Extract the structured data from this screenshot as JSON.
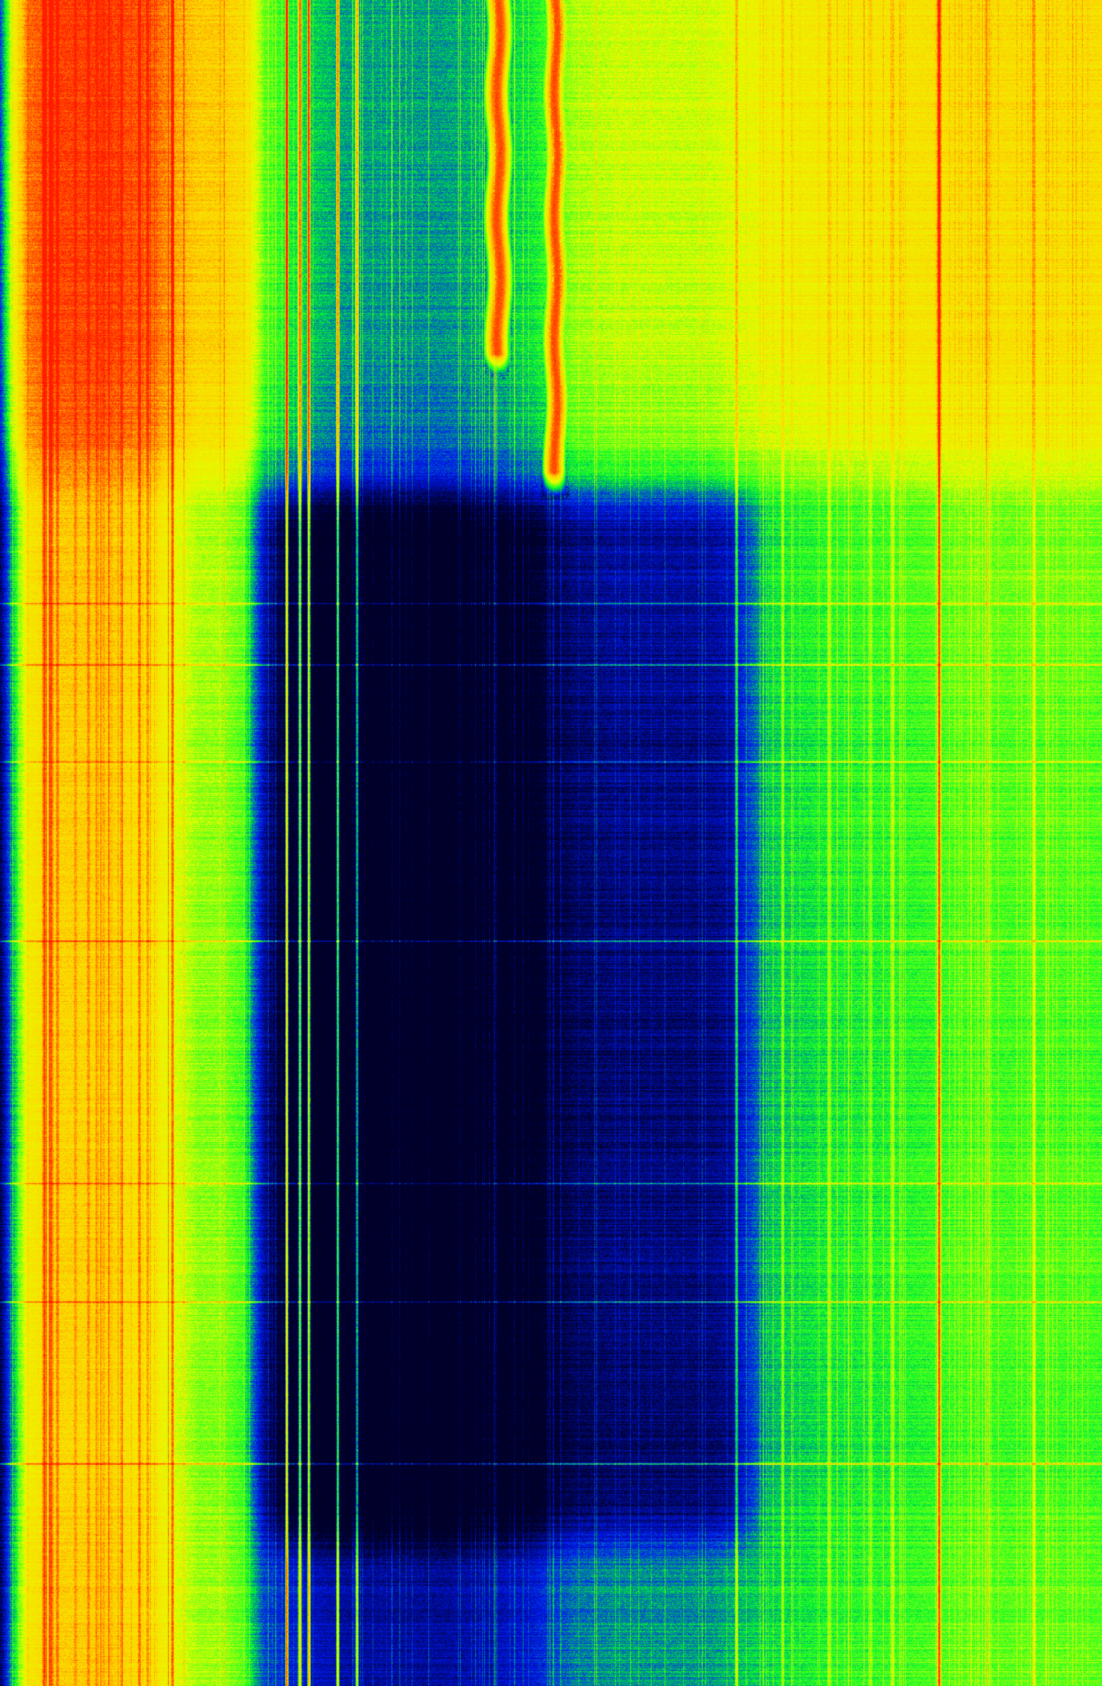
{
  "image": {
    "kind": "spectrogram-waterfall",
    "colormap": [
      "#00002a",
      "#0018ff",
      "#00ff28",
      "#e6ff00",
      "#ffd300",
      "#ff1a00"
    ],
    "background_color": "#1fb89e"
  },
  "chart_data": {
    "type": "heatmap",
    "title": "",
    "xlabel": "",
    "ylabel": "",
    "value_range": [
      0,
      1
    ],
    "column_profile": [
      [
        0.0,
        0.05
      ],
      [
        0.012,
        0.38
      ],
      [
        0.025,
        0.72
      ],
      [
        0.05,
        0.8
      ],
      [
        0.1,
        0.8
      ],
      [
        0.14,
        0.74
      ],
      [
        0.16,
        0.64
      ],
      [
        0.18,
        0.56
      ],
      [
        0.2,
        0.56
      ],
      [
        0.22,
        0.5
      ],
      [
        0.24,
        0.25
      ],
      [
        0.28,
        0.16
      ],
      [
        0.32,
        0.12
      ],
      [
        0.36,
        0.12
      ],
      [
        0.4,
        0.12
      ],
      [
        0.44,
        0.14
      ],
      [
        0.48,
        0.18
      ],
      [
        0.52,
        0.3
      ],
      [
        0.56,
        0.33
      ],
      [
        0.6,
        0.33
      ],
      [
        0.64,
        0.33
      ],
      [
        0.68,
        0.38
      ],
      [
        0.72,
        0.42
      ],
      [
        0.76,
        0.45
      ],
      [
        0.8,
        0.46
      ],
      [
        0.84,
        0.48
      ],
      [
        0.87,
        0.5
      ],
      [
        0.9,
        0.5
      ],
      [
        0.95,
        0.5
      ],
      [
        1.0,
        0.5
      ]
    ],
    "row_profile": [
      [
        0.0,
        0.28
      ],
      [
        0.2,
        0.26
      ],
      [
        0.26,
        0.2
      ],
      [
        0.3,
        0.0
      ],
      [
        0.45,
        -0.03
      ],
      [
        0.62,
        -0.05
      ],
      [
        0.74,
        -0.04
      ],
      [
        0.86,
        -0.06
      ],
      [
        0.93,
        -0.03
      ],
      [
        1.0,
        -0.02
      ]
    ],
    "dim_region": {
      "x": [
        0.22,
        0.7
      ],
      "y": [
        0.28,
        0.93
      ],
      "amount": 0.22
    },
    "bright_tracks": [
      {
        "x": 0.452,
        "width": 0.022,
        "y_end": 0.21,
        "level": 0.95
      },
      {
        "x": 0.504,
        "width": 0.02,
        "y_end": 0.28,
        "level": 0.95
      },
      {
        "x": 0.205,
        "width": 0.018,
        "y_end": 0.2,
        "level": 0.68
      }
    ],
    "vertical_lines": [
      {
        "x": 0.04,
        "level": 0.98,
        "w": 3
      },
      {
        "x": 0.046,
        "level": 0.96,
        "w": 3
      },
      {
        "x": 0.052,
        "level": 0.92,
        "w": 2
      },
      {
        "x": 0.068,
        "level": 0.88,
        "w": 2
      },
      {
        "x": 0.08,
        "level": 0.9,
        "w": 2
      },
      {
        "x": 0.088,
        "level": 0.86,
        "w": 2
      },
      {
        "x": 0.094,
        "level": 0.86,
        "w": 2
      },
      {
        "x": 0.11,
        "level": 0.88,
        "w": 2
      },
      {
        "x": 0.126,
        "level": 0.92,
        "w": 2
      },
      {
        "x": 0.134,
        "level": 0.88,
        "w": 2
      },
      {
        "x": 0.156,
        "level": 0.94,
        "w": 2
      },
      {
        "x": 0.26,
        "level": 0.86,
        "w": 2
      },
      {
        "x": 0.272,
        "level": 0.72,
        "w": 2
      },
      {
        "x": 0.28,
        "level": 0.7,
        "w": 2
      },
      {
        "x": 0.306,
        "level": 0.66,
        "w": 2
      },
      {
        "x": 0.324,
        "level": 0.58,
        "w": 2
      },
      {
        "x": 0.668,
        "level": 0.62,
        "w": 2
      },
      {
        "x": 0.71,
        "level": 0.56,
        "w": 2
      },
      {
        "x": 0.752,
        "level": 0.58,
        "w": 2
      },
      {
        "x": 0.79,
        "level": 0.56,
        "w": 2
      },
      {
        "x": 0.81,
        "level": 0.6,
        "w": 2
      },
      {
        "x": 0.852,
        "level": 0.94,
        "w": 3
      },
      {
        "x": 0.938,
        "level": 0.66,
        "w": 2
      }
    ],
    "horizontal_bands": [
      {
        "y": 0.358,
        "level": 0.3
      },
      {
        "y": 0.394,
        "level": 0.28
      },
      {
        "y": 0.452,
        "level": 0.25
      },
      {
        "y": 0.558,
        "level": 0.3
      },
      {
        "y": 0.702,
        "level": 0.32
      },
      {
        "y": 0.772,
        "level": 0.36
      },
      {
        "y": 0.868,
        "level": 0.4
      }
    ]
  }
}
